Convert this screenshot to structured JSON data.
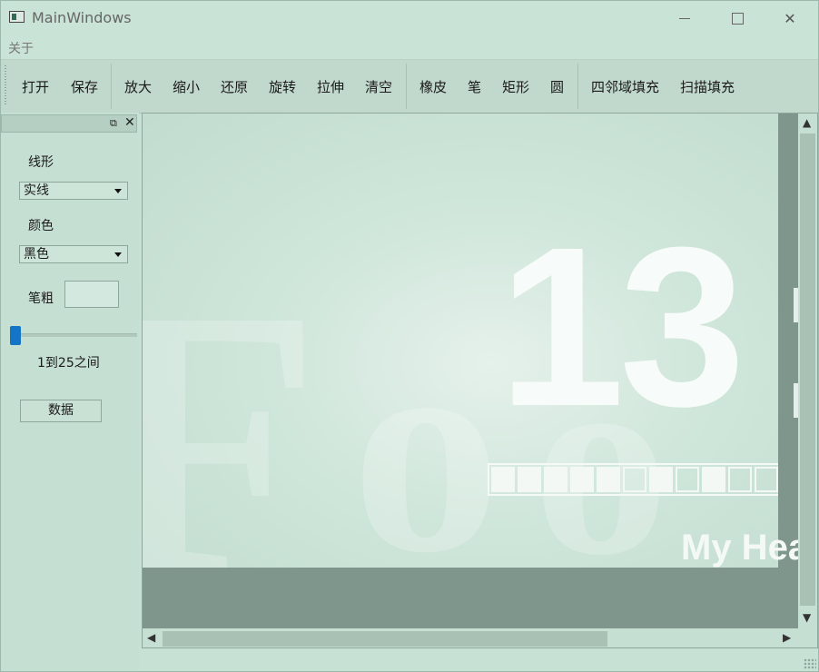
{
  "window": {
    "title": "MainWindows",
    "minimize_glyph": "minimize-icon",
    "maximize_glyph": "maximize-icon",
    "close_glyph": "✕"
  },
  "menubar": {
    "items": [
      "关于"
    ]
  },
  "toolbar": {
    "groups": [
      [
        "打开",
        "保存"
      ],
      [
        "放大",
        "缩小",
        "还原",
        "旋转",
        "拉伸",
        "清空"
      ],
      [
        "橡皮",
        "笔",
        "矩形",
        "圆"
      ],
      [
        "四邻域填充",
        "扫描填充"
      ]
    ]
  },
  "dock": {
    "float_glyph": "⧉",
    "close_glyph": "✕",
    "line_style_label": "线形",
    "line_style_value": "实线",
    "color_label": "颜色",
    "color_value": "黑色",
    "pen_width_label": "笔粗",
    "pen_width_value": "",
    "range_text": "1到25之间",
    "data_button": "数据",
    "slider_level": 0
  },
  "canvas": {
    "big_text": "13",
    "sub_text": "My Heal",
    "progress_cells": [
      1,
      1,
      1,
      1,
      1,
      0,
      1,
      0,
      1,
      0,
      0,
      1
    ]
  },
  "scroll": {
    "up": "▲",
    "down": "▼",
    "left": "◀",
    "right": "▶"
  },
  "colors": {
    "window_bg": "#c7e1d5",
    "slider_handle": "#1475c7",
    "canvas_dark": "#7f968c"
  }
}
